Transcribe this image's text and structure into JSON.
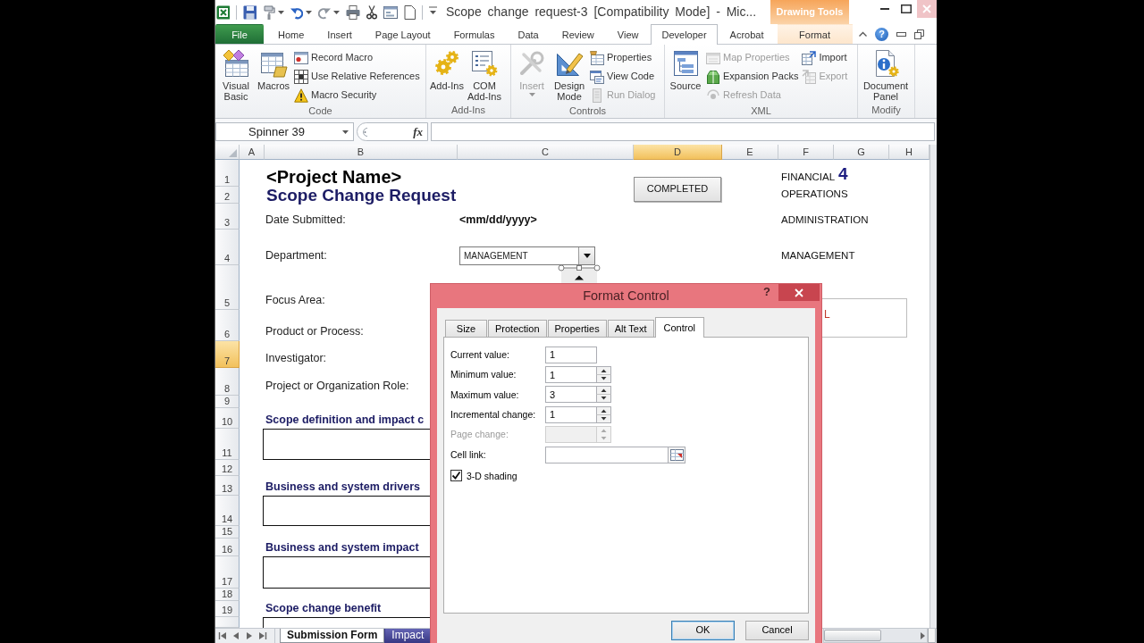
{
  "window": {
    "title": "Scope change request-3 [Compatibility Mode] - Mic...",
    "context_group": "Drawing Tools"
  },
  "ribbon_tabs": [
    {
      "label": "File",
      "kind": "file",
      "selected": false
    },
    {
      "label": "Home",
      "kind": "standard",
      "selected": false
    },
    {
      "label": "Insert",
      "kind": "standard",
      "selected": false
    },
    {
      "label": "Page Layout",
      "kind": "standard",
      "selected": false
    },
    {
      "label": "Formulas",
      "kind": "standard",
      "selected": false
    },
    {
      "label": "Data",
      "kind": "standard",
      "selected": false
    },
    {
      "label": "Review",
      "kind": "standard",
      "selected": false
    },
    {
      "label": "View",
      "kind": "standard",
      "selected": false
    },
    {
      "label": "Developer",
      "kind": "standard",
      "selected": true
    },
    {
      "label": "Acrobat",
      "kind": "standard",
      "selected": false
    },
    {
      "label": "Format",
      "kind": "contextual",
      "selected": false
    }
  ],
  "ribbon_help": "?",
  "ribbon_groups": [
    {
      "label": "Code",
      "commands": [
        {
          "kind": "large",
          "label": "Visual Basic",
          "disabled": false,
          "dropdown": false
        },
        {
          "kind": "large",
          "label": "Macros",
          "disabled": false,
          "dropdown": false
        },
        {
          "kind": "stack",
          "items": [
            {
              "label": "Record Macro",
              "disabled": false
            },
            {
              "label": "Use Relative References",
              "disabled": false
            },
            {
              "label": "Macro Security",
              "disabled": false
            }
          ]
        }
      ]
    },
    {
      "label": "Add-Ins",
      "commands": [
        {
          "kind": "large",
          "label": "Add-Ins",
          "disabled": false,
          "dropdown": false
        },
        {
          "kind": "large",
          "label": "COM Add-Ins",
          "disabled": false,
          "dropdown": false
        }
      ]
    },
    {
      "label": "Controls",
      "commands": [
        {
          "kind": "large",
          "label": "Insert",
          "disabled": true,
          "dropdown": true
        },
        {
          "kind": "large",
          "label": "Design Mode",
          "disabled": false,
          "dropdown": false
        },
        {
          "kind": "stack",
          "items": [
            {
              "label": "Properties",
              "disabled": false
            },
            {
              "label": "View Code",
              "disabled": false
            },
            {
              "label": "Run Dialog",
              "disabled": true
            }
          ]
        }
      ]
    },
    {
      "label": "XML",
      "commands": [
        {
          "kind": "large",
          "label": "Source",
          "disabled": false,
          "dropdown": false
        },
        {
          "kind": "stack",
          "items": [
            {
              "label": "Map Properties",
              "disabled": true
            },
            {
              "label": "Expansion Packs",
              "disabled": false
            },
            {
              "label": "Refresh Data",
              "disabled": true
            }
          ]
        },
        {
          "kind": "stack",
          "items": [
            {
              "label": "Import",
              "disabled": false
            },
            {
              "label": "Export",
              "disabled": true
            }
          ]
        }
      ]
    },
    {
      "label": "Modify",
      "commands": [
        {
          "kind": "large",
          "label": "Document Panel",
          "disabled": false,
          "dropdown": false
        }
      ]
    }
  ],
  "name_box": "Spinner 39",
  "formula_bar": {
    "function_label": "fx"
  },
  "columns": [
    {
      "label": "A",
      "selected": false
    },
    {
      "label": "B",
      "selected": false
    },
    {
      "label": "C",
      "selected": false
    },
    {
      "label": "D",
      "selected": true
    },
    {
      "label": "E",
      "selected": false
    },
    {
      "label": "F",
      "selected": false
    },
    {
      "label": "G",
      "selected": false
    },
    {
      "label": "H",
      "selected": false
    }
  ],
  "rows": [
    {
      "label": "1",
      "selected": false
    },
    {
      "label": "2",
      "selected": false
    },
    {
      "label": "3",
      "selected": false
    },
    {
      "label": "4",
      "selected": false
    },
    {
      "label": "5",
      "selected": false
    },
    {
      "label": "6",
      "selected": false
    },
    {
      "label": "7",
      "selected": true
    },
    {
      "label": "8",
      "selected": false
    },
    {
      "label": "9",
      "selected": false
    },
    {
      "label": "10",
      "selected": false
    },
    {
      "label": "11",
      "selected": false
    },
    {
      "label": "12",
      "selected": false
    },
    {
      "label": "13",
      "selected": false
    },
    {
      "label": "14",
      "selected": false
    },
    {
      "label": "15",
      "selected": false
    },
    {
      "label": "16",
      "selected": false
    },
    {
      "label": "17",
      "selected": false
    },
    {
      "label": "18",
      "selected": false
    },
    {
      "label": "19",
      "selected": false
    }
  ],
  "form": {
    "title": "<Project Name>",
    "subtitle": "Scope Change Request",
    "status_button": "COMPLETED",
    "list": [
      "FINANCIAL",
      "OPERATIONS",
      "ADMINISTRATION",
      "MANAGEMENT"
    ],
    "counter": "4",
    "fields": [
      {
        "label": "Date Submitted:",
        "kind": "text",
        "value": "<mm/dd/yyyy>"
      },
      {
        "label": "Department:",
        "kind": "dropdown",
        "value": "MANAGEMENT"
      },
      {
        "label": "Focus Area:",
        "kind": "blank"
      },
      {
        "label": "Product or Process:",
        "kind": "blank"
      },
      {
        "label": "Investigator:",
        "kind": "blank"
      },
      {
        "label": "Project or Organization Role:",
        "kind": "blank"
      }
    ],
    "sections": [
      {
        "heading": "Scope definition and impact c"
      },
      {
        "heading": "Business and system drivers"
      },
      {
        "heading": "Business and system impact"
      },
      {
        "heading": "Scope change benefit"
      }
    ],
    "shape_text": "L"
  },
  "spinner": {
    "selected": true
  },
  "sheet_tabs": [
    {
      "label": "Submission Form",
      "selected": true
    },
    {
      "label": "Impact",
      "selected": false
    }
  ],
  "dialog": {
    "title": "Format Control",
    "help": "?",
    "tabs": [
      {
        "label": "Size",
        "selected": false
      },
      {
        "label": "Protection",
        "selected": false
      },
      {
        "label": "Properties",
        "selected": false
      },
      {
        "label": "Alt Text",
        "selected": false
      },
      {
        "label": "Control",
        "selected": true
      }
    ],
    "fields": [
      {
        "label": "Current value:",
        "kind": "text",
        "value": "1",
        "disabled": false
      },
      {
        "label": "Minimum value:",
        "kind": "spin",
        "value": "1",
        "disabled": false
      },
      {
        "label": "Maximum value:",
        "kind": "spin",
        "value": "3",
        "disabled": false
      },
      {
        "label": "Incremental change:",
        "kind": "spin",
        "value": "1",
        "disabled": false
      },
      {
        "label": "Page change:",
        "kind": "spin",
        "disabled": true
      },
      {
        "label": "Cell link:",
        "kind": "reference",
        "disabled": false
      }
    ],
    "checkbox": {
      "label": "3-D shading",
      "checked": true
    },
    "buttons": [
      {
        "label": "OK",
        "default": true
      },
      {
        "label": "Cancel",
        "default": false
      }
    ]
  }
}
